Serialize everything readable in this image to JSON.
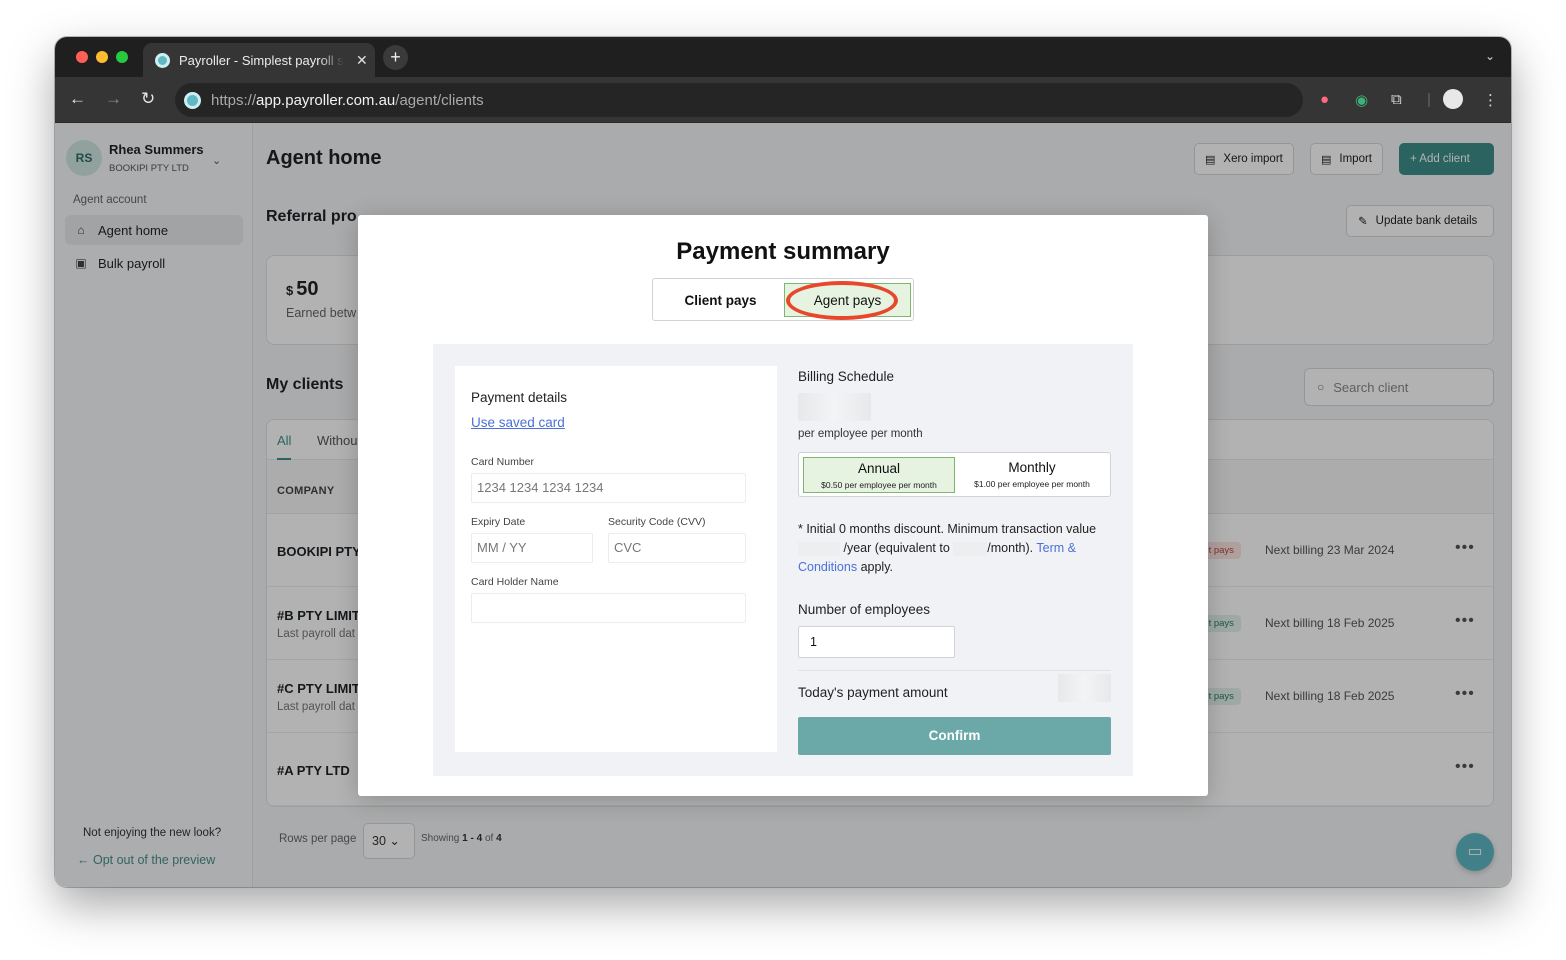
{
  "browser": {
    "tab_title": "Payroller - Simplest payroll software",
    "tab_close": "✕",
    "new_tab": "+",
    "tab_menu": "⌄",
    "url_scheme": "https://",
    "url_host": "app.payroller.com.au",
    "url_path": "/agent/clients"
  },
  "sidebar": {
    "avatar_initials": "RS",
    "user_name": "Rhea Summers",
    "company": "BOOKIPI PTY LTD",
    "section_label": "Agent account",
    "items": [
      {
        "label": "Agent home",
        "icon": "home-icon",
        "active": true
      },
      {
        "label": "Bulk payroll",
        "icon": "payroll-icon",
        "active": false
      }
    ],
    "footer_question": "Not enjoying the new look?",
    "footer_link": "← Opt out of the preview"
  },
  "header": {
    "title": "Agent home",
    "xero_import": "Xero import",
    "import": "Import",
    "add_client": "+ Add client"
  },
  "referral": {
    "title": "Referral pro",
    "update_bank": "Update bank details",
    "currency": "$",
    "amount": "50",
    "subtitle": "Earned betw"
  },
  "clients": {
    "title": "My clients",
    "search_placeholder": "Search client",
    "tabs": [
      "All",
      "Withou"
    ],
    "column_company": "COMPANY",
    "rows": [
      {
        "name": "BOOKIPI PTY",
        "sub": "",
        "badge": "ent pays",
        "badge_tone": "red",
        "next": "Next billing 23 Mar 2024",
        "more": "•••"
      },
      {
        "name": "#B PTY LIMIT",
        "sub": "Last payroll dat",
        "badge": "ent pays",
        "badge_tone": "green",
        "next": "Next billing 18 Feb 2025",
        "more": "•••"
      },
      {
        "name": "#C PTY LIMIT",
        "sub": "Last payroll dat",
        "badge": "ent pays",
        "badge_tone": "green",
        "next": "Next billing 18 Feb 2025",
        "more": "•••"
      },
      {
        "name": "#A PTY LTD",
        "sub": "",
        "badge": "",
        "badge_tone": "",
        "next": "",
        "more": "•••"
      }
    ],
    "rows_per_page_label": "Rows per page",
    "rows_per_page": "30",
    "showing_prefix": "Showing",
    "showing_range": "1 - 4",
    "showing_of": "of",
    "showing_total": "4"
  },
  "modal": {
    "title": "Payment summary",
    "toggle": {
      "client": "Client pays",
      "agent": "Agent pays",
      "selected": "agent"
    },
    "payment_details": {
      "title": "Payment details",
      "saved_card_link": "Use saved card",
      "card_number_label": "Card Number",
      "card_number_placeholder": "1234 1234 1234 1234",
      "expiry_label": "Expiry Date",
      "expiry_placeholder": "MM / YY",
      "cvv_label": "Security Code (CVV)",
      "cvv_placeholder": "CVC",
      "holder_label": "Card Holder Name",
      "holder_value": ""
    },
    "billing": {
      "title": "Billing Schedule",
      "per_employee": "per employee per month",
      "plans": [
        {
          "name": "Annual",
          "price": "$0.50 per employee per month",
          "selected": true
        },
        {
          "name": "Monthly",
          "price": "$1.00 per employee per month",
          "selected": false
        }
      ],
      "disc_part1": "* Initial 0 months discount. Minimum transaction value",
      "disc_part2": "/year (equivalent to",
      "disc_part3": "/month).",
      "terms_link": "Term & Conditions",
      "disc_part4": "apply.",
      "employees_label": "Number of employees",
      "employees_value": "1",
      "today_label": "Today's payment amount",
      "confirm": "Confirm"
    }
  }
}
